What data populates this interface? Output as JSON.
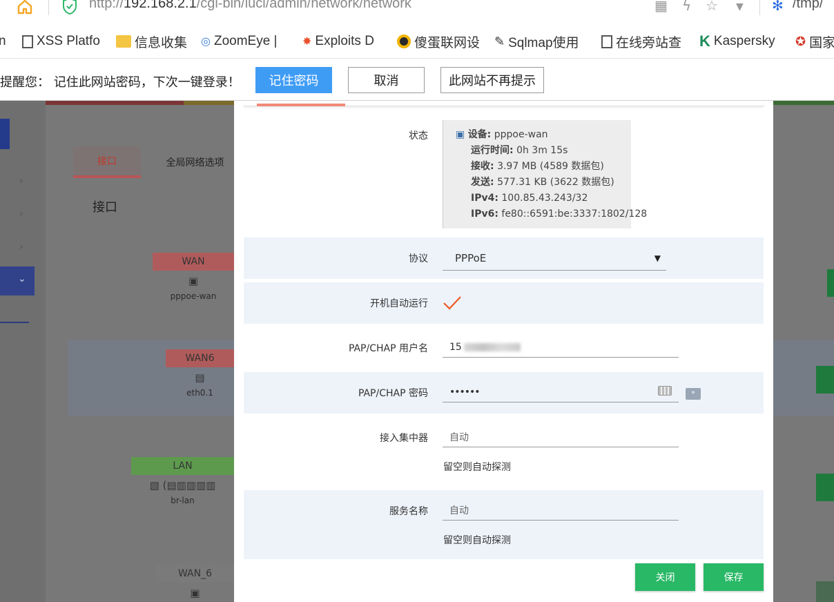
{
  "browser": {
    "url_prefix": "http://",
    "url_host": "192.168.2.1",
    "url_path": "/cgi-bin/luci/admin/network/network",
    "tail_text": "/tmp/"
  },
  "bookmarks": [
    {
      "label": "n"
    },
    {
      "label": "XSS Platfo",
      "icon": "document-icon"
    },
    {
      "label": "信息收集",
      "icon": "folder-icon"
    },
    {
      "label": "ZoomEye |",
      "icon": "eye-icon"
    },
    {
      "label": "Exploits D",
      "icon": "bug-icon"
    },
    {
      "label": "傻蛋联网设",
      "icon": "circle-icon"
    },
    {
      "label": "Sqlmap使用",
      "icon": "pen-icon"
    },
    {
      "label": "在线旁站查",
      "icon": "document-icon"
    },
    {
      "label": "Kaspersky",
      "icon": "kaspersky-icon"
    },
    {
      "label": "国家",
      "icon": "emblem-icon"
    }
  ],
  "save_password_bar": {
    "message": "提醒您： 记住此网站密码，下次一键登录！",
    "remember_label": "记住密码",
    "cancel_label": "取消",
    "never_label": "此网站不再提示"
  },
  "background": {
    "tabs": [
      "接口",
      "全局网络选项"
    ],
    "heading": "接口",
    "interfaces": [
      {
        "name": "WAN",
        "device": "pppoe-wan",
        "color": "#b05b5b"
      },
      {
        "name": "WAN6",
        "device": "eth0.1",
        "color": "#b05b5b"
      },
      {
        "name": "LAN",
        "device": "br-lan",
        "color": "#5e9a4e"
      },
      {
        "name": "WAN_6",
        "device": "",
        "color": "#7a7a7a"
      }
    ]
  },
  "modal": {
    "status": {
      "label": "状态",
      "device_key": "设备:",
      "device_val": "pppoe-wan",
      "uptime_key": "运行时间:",
      "uptime_val": "0h 3m 15s",
      "rx_key": "接收:",
      "rx_val": "3.97 MB (4589 数据包)",
      "tx_key": "发送:",
      "tx_val": "577.31 KB (3622 数据包)",
      "ipv4_key": "IPv4:",
      "ipv4_val": "100.85.43.243/32",
      "ipv6_key": "IPv6:",
      "ipv6_val": "fe80::6591:be:3337:1802/128"
    },
    "protocol": {
      "label": "协议",
      "value": "PPPoE"
    },
    "autostart": {
      "label": "开机自动运行",
      "checked": true
    },
    "username": {
      "label": "PAP/CHAP 用户名",
      "value": "15"
    },
    "password": {
      "label": "PAP/CHAP 密码",
      "value": "••••••"
    },
    "concentrator": {
      "label": "接入集中器",
      "placeholder": "自动",
      "hint": "留空则自动探测"
    },
    "service": {
      "label": "服务名称",
      "placeholder": "自动",
      "hint": "留空则自动探测"
    },
    "close_label": "关闭",
    "save_label": "保存"
  },
  "colors": {
    "accent_blue": "#3f9cf5",
    "primary_green": "#29b866",
    "check_orange": "#ee5a24"
  }
}
